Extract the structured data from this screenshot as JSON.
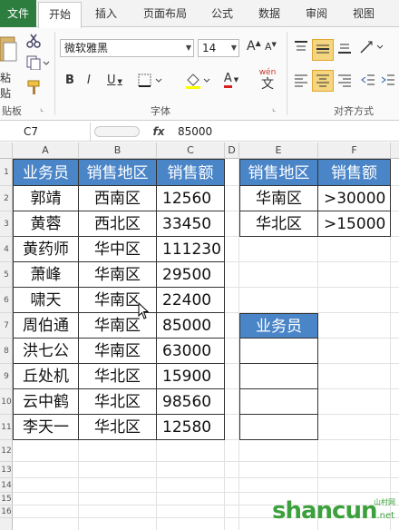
{
  "ribbon": {
    "tabs": [
      {
        "label": "文件"
      },
      {
        "label": "开始"
      },
      {
        "label": "插入"
      },
      {
        "label": "页面布局"
      },
      {
        "label": "公式"
      },
      {
        "label": "数据"
      },
      {
        "label": "审阅"
      },
      {
        "label": "视图"
      }
    ],
    "clipboard_label": "贴板",
    "paste_label": "粘贴",
    "font_group_label": "字体",
    "align_group_label": "对齐方式",
    "font_name": "微软雅黑",
    "font_size": "14",
    "font_grow": "A",
    "font_shrink": "A",
    "bold": "B",
    "italic": "I",
    "underline": "U",
    "font_color_glyph": "A",
    "phonetic_glyph": "wén",
    "phonetic_char": "文"
  },
  "formula_bar": {
    "name_box": "C7",
    "fx": "fx",
    "value": "85000"
  },
  "columns": [
    "A",
    "B",
    "C",
    "D",
    "E",
    "F"
  ],
  "rows": [
    "1",
    "2",
    "3",
    "4",
    "5",
    "6",
    "7",
    "8",
    "9",
    "10",
    "11",
    "12",
    "13",
    "14",
    "15",
    "16"
  ],
  "sales_table": {
    "headers": [
      "业务员",
      "销售地区",
      "销售额"
    ],
    "rows": [
      [
        "郭靖",
        "西南区",
        "12560"
      ],
      [
        "黄蓉",
        "西北区",
        "33450"
      ],
      [
        "黄药师",
        "华中区",
        "111230"
      ],
      [
        "萧峰",
        "华南区",
        "29500"
      ],
      [
        "啸天",
        "华南区",
        "22400"
      ],
      [
        "周伯通",
        "华南区",
        "85000"
      ],
      [
        "洪七公",
        "华南区",
        "63000"
      ],
      [
        "丘处机",
        "华北区",
        "15900"
      ],
      [
        "云中鹤",
        "华北区",
        "98560"
      ],
      [
        "李天一",
        "华北区",
        "12580"
      ]
    ]
  },
  "criteria_table": {
    "headers": [
      "销售地区",
      "销售额"
    ],
    "rows": [
      [
        "华南区",
        ">30000"
      ],
      [
        "华北区",
        ">15000"
      ]
    ]
  },
  "output_table": {
    "header": "业务员",
    "empty_rows": 4
  },
  "watermark": {
    "text": "shancun",
    "suffix": ".net",
    "small": "山村网"
  }
}
